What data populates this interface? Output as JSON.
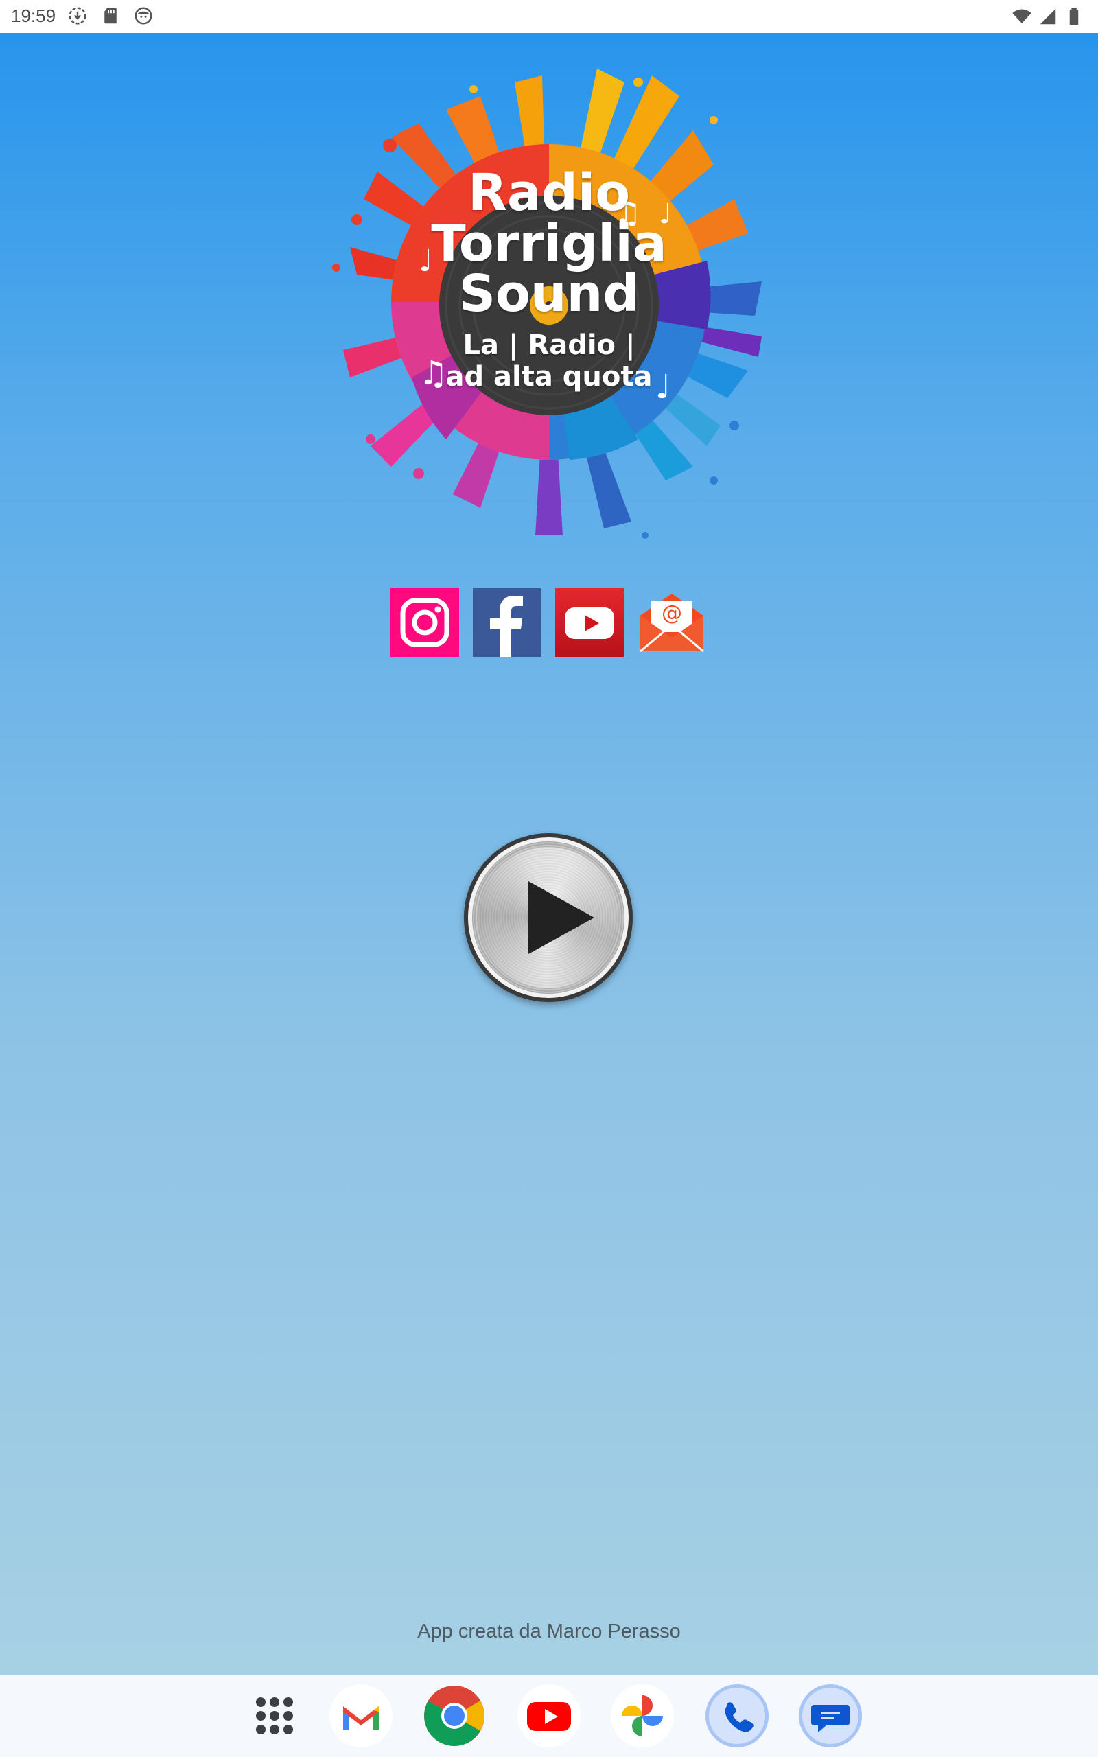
{
  "status_bar": {
    "time": "19:59",
    "left_icons": [
      "download-status-icon",
      "sd-card-icon",
      "face-icon"
    ],
    "right_icons": [
      "wifi-icon",
      "cell-signal-icon",
      "battery-icon"
    ]
  },
  "logo": {
    "line1": "Radio",
    "line2": "Torriglia",
    "line3": "Sound",
    "tagline1": "La | Radio |",
    "tagline2": "ad alta quota"
  },
  "social": [
    {
      "name": "instagram",
      "icon": "instagram-icon",
      "color": "#ff0a7e"
    },
    {
      "name": "facebook",
      "icon": "facebook-icon",
      "color": "#3b5998"
    },
    {
      "name": "youtube",
      "icon": "youtube-icon",
      "color": "#d4141c"
    },
    {
      "name": "email",
      "icon": "email-icon",
      "color": "#ef4a23"
    }
  ],
  "player": {
    "icon": "play-icon"
  },
  "credit": "App creata da Marco Perasso",
  "dock": [
    {
      "app": "all-apps",
      "icon": "app-grid-icon"
    },
    {
      "app": "gmail",
      "icon": "gmail-icon"
    },
    {
      "app": "chrome",
      "icon": "chrome-icon"
    },
    {
      "app": "youtube",
      "icon": "youtube-app-icon"
    },
    {
      "app": "photos",
      "icon": "photos-icon"
    },
    {
      "app": "phone",
      "icon": "phone-icon"
    },
    {
      "app": "messages",
      "icon": "messages-icon"
    }
  ]
}
